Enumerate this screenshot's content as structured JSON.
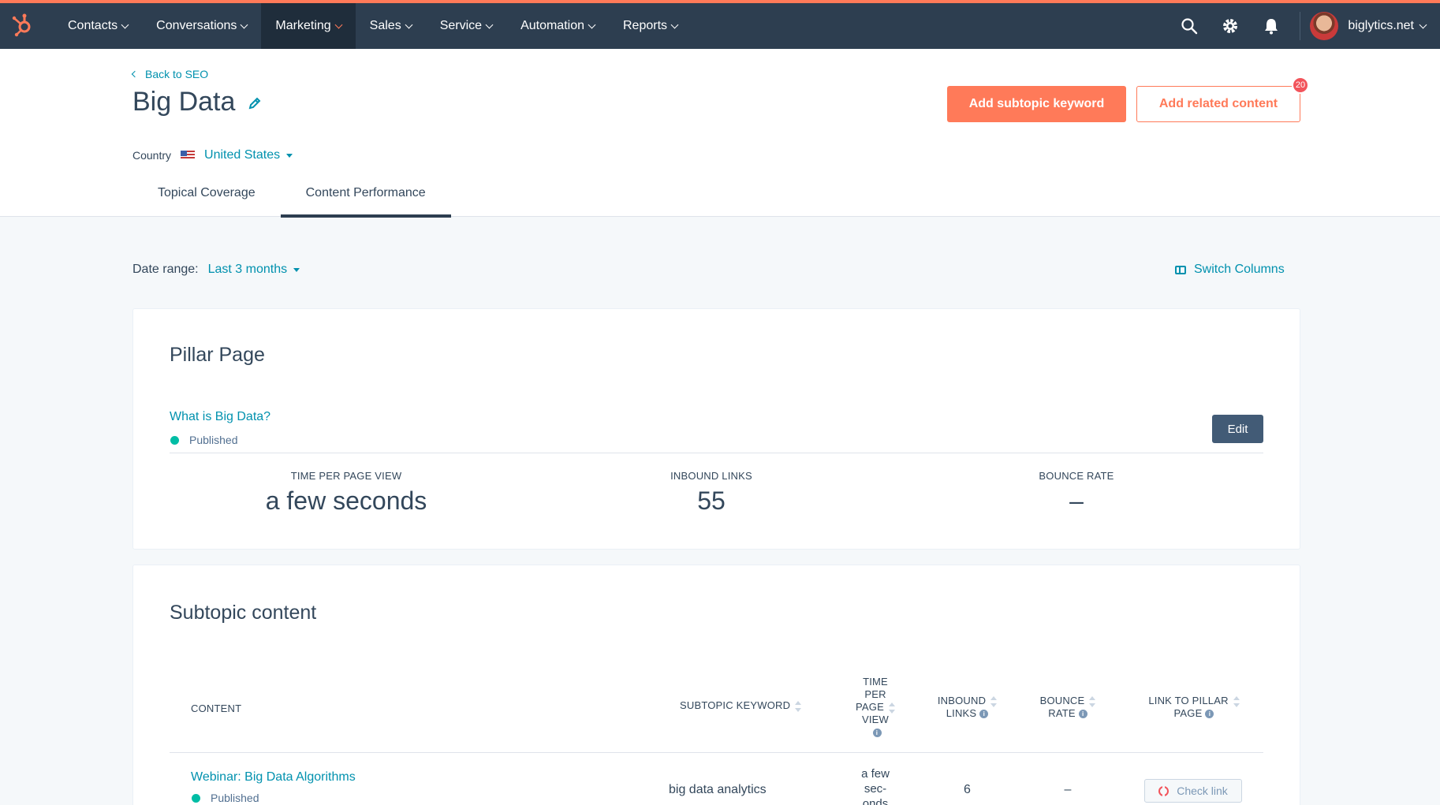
{
  "nav": {
    "items": [
      {
        "label": "Contacts"
      },
      {
        "label": "Conversations"
      },
      {
        "label": "Marketing"
      },
      {
        "label": "Sales"
      },
      {
        "label": "Service"
      },
      {
        "label": "Automation"
      },
      {
        "label": "Reports"
      }
    ],
    "active": "Marketing",
    "account": "biglytics.net",
    "accent_color": "#ff7a59"
  },
  "header": {
    "back_label": "Back to SEO",
    "title": "Big Data",
    "primary_button": "Add subtopic keyword",
    "secondary_button": "Add related content",
    "badge_count": "20",
    "country_label": "Country",
    "country_value": "United States",
    "tabs": [
      {
        "label": "Topical Coverage"
      },
      {
        "label": "Content Performance"
      }
    ]
  },
  "controls": {
    "date_range_label": "Date range:",
    "date_range_value": "Last 3 months",
    "switch_columns": "Switch Columns"
  },
  "pillar": {
    "heading": "Pillar Page",
    "page_link": "What is Big Data?",
    "status": "Published",
    "edit_button": "Edit",
    "stats": [
      {
        "label": "TIME PER PAGE VIEW",
        "value": "a few seconds"
      },
      {
        "label": "INBOUND LINKS",
        "value": "55"
      },
      {
        "label": "BOUNCE RATE",
        "value": "–"
      }
    ]
  },
  "subtopic": {
    "heading": "Subtopic content",
    "columns": {
      "content": "CONTENT",
      "keyword": "SUBTOPIC KEYWORD",
      "time_lines": [
        "TIME",
        "PER",
        "PAGE",
        "VIEW"
      ],
      "inbound_lines": [
        "INBOUND",
        "LINKS"
      ],
      "bounce_lines": [
        "BOUNCE",
        "RATE"
      ],
      "link_lines": [
        "LINK TO PILLAR",
        "PAGE"
      ]
    },
    "rows": [
      {
        "content": "Webinar: Big Data Algorithms",
        "status": "Published",
        "keyword": "big data analytics",
        "time_lines": [
          "a few",
          "sec-",
          "onds"
        ],
        "inbound": "6",
        "bounce": "–",
        "link_action": "Check link"
      }
    ]
  }
}
